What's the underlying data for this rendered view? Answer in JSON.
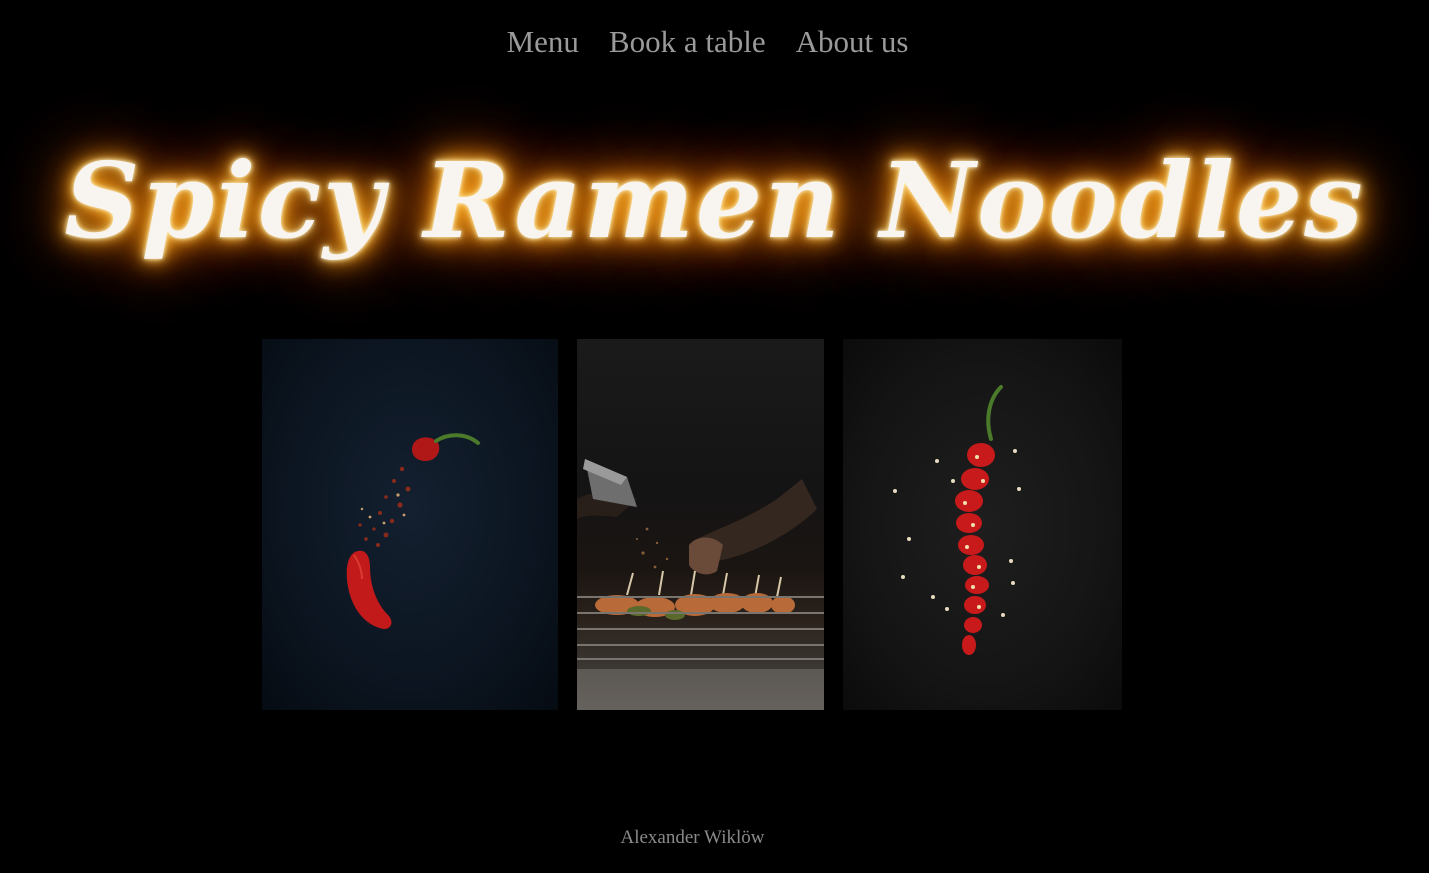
{
  "nav": {
    "items": [
      {
        "label": "Menu"
      },
      {
        "label": "Book a table"
      },
      {
        "label": "About us"
      }
    ]
  },
  "hero": {
    "title": "Spicy Ramen Noodles",
    "glow_color": "#ffb020"
  },
  "gallery": {
    "images": [
      {
        "subject": "red chili pepper with flakes on dark blue background"
      },
      {
        "subject": "chef seasoning skewers on a grill"
      },
      {
        "subject": "sliced red chili pepper with seeds on dark background"
      }
    ]
  },
  "footer": {
    "author": "Alexander Wiklöw"
  },
  "colors": {
    "background": "#000000",
    "nav_text": "#9a9a9a",
    "title_text": "#f8f5f0",
    "footer_text": "#8a8a8a"
  }
}
